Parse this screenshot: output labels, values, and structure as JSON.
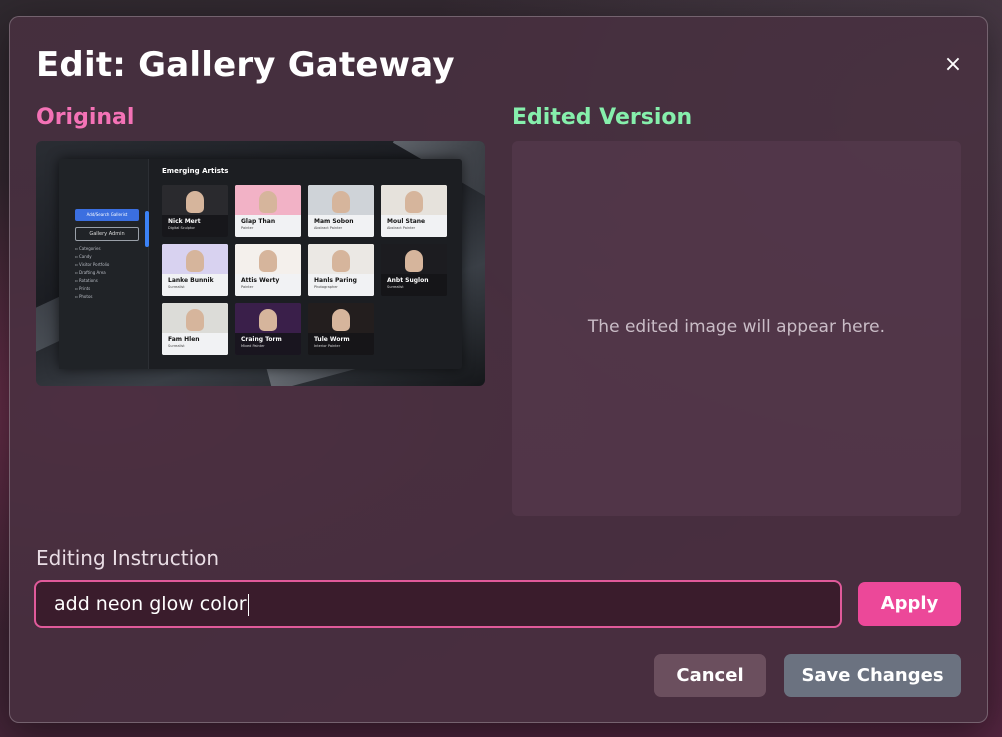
{
  "modal": {
    "title": "Edit: Gallery Gateway",
    "close_label": "×"
  },
  "original": {
    "label": "Original",
    "preview": {
      "heading": "Emerging Artists",
      "primary_button": "Add/Search Gallerist",
      "secondary_button": "Gallery Admin",
      "nav_items": [
        "Categories",
        "Candy",
        "Visitor Portfolio",
        "Drafting Area",
        "Rotations",
        "Prints",
        "Photos"
      ],
      "cards": [
        {
          "name": "Nick Mert",
          "sub": "Digital Sculptor",
          "style": "dark",
          "photo": "#2a2a2e"
        },
        {
          "name": "Glap Than",
          "sub": "Painter",
          "style": "light",
          "photo": "#f2b2c6"
        },
        {
          "name": "Mam Sobon",
          "sub": "Abstract Painter",
          "style": "light",
          "photo": "#cfd3d8"
        },
        {
          "name": "Moul Stane",
          "sub": "Abstract Painter",
          "style": "light",
          "photo": "#e6e2dc"
        },
        {
          "name": "Lanke Bunnik",
          "sub": "Surrealist",
          "style": "light",
          "photo": "#d8d2f0"
        },
        {
          "name": "Attis Werty",
          "sub": "Painter",
          "style": "light",
          "photo": "#f4f0ec"
        },
        {
          "name": "Hanls Paring",
          "sub": "Photographer",
          "style": "light",
          "photo": "#ebe8e4"
        },
        {
          "name": "Anbt Suglon",
          "sub": "Surrealist",
          "style": "dark",
          "photo": "#1c1c20"
        },
        {
          "name": "Fam Hlen",
          "sub": "Surrealist",
          "style": "light",
          "photo": "#dcdcd8"
        },
        {
          "name": "Craing Torm",
          "sub": "Mixed Painter",
          "style": "dark",
          "photo": "#3a1f4a"
        },
        {
          "name": "Tule Worm",
          "sub": "Interior Painter",
          "style": "dark",
          "photo": "#231e1e"
        }
      ]
    }
  },
  "edited": {
    "label": "Edited Version",
    "placeholder": "The edited image will appear here."
  },
  "instruction": {
    "label": "Editing Instruction",
    "value": "add neon glow color"
  },
  "buttons": {
    "apply": "Apply",
    "cancel": "Cancel",
    "save": "Save Changes"
  },
  "colors": {
    "accent_pink": "#ec4899",
    "original_label": "#f472b6",
    "edited_label": "#86efac",
    "save_button": "#6b7280"
  }
}
